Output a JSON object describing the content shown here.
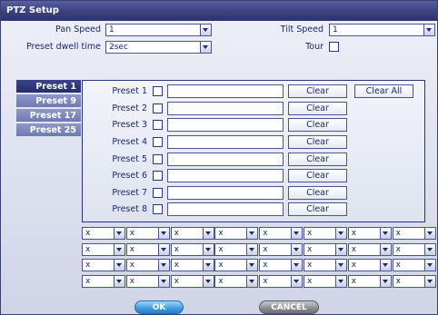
{
  "window": {
    "title": "PTZ Setup"
  },
  "settings": {
    "pan_speed_label": "Pan Speed",
    "pan_speed_value": "1",
    "tilt_speed_label": "Tilt Speed",
    "tilt_speed_value": "1",
    "dwell_label": "Preset dwell time",
    "dwell_value": "2sec",
    "tour_label": "Tour"
  },
  "tabs": [
    {
      "label": "Preset 1",
      "active": true
    },
    {
      "label": "Preset 9",
      "active": false
    },
    {
      "label": "Preset 17",
      "active": false
    },
    {
      "label": "Preset 25",
      "active": false
    }
  ],
  "presets": [
    {
      "label": "Preset 1",
      "clear_label": "Clear"
    },
    {
      "label": "Preset 2",
      "clear_label": "Clear"
    },
    {
      "label": "Preset 3",
      "clear_label": "Clear"
    },
    {
      "label": "Preset 4",
      "clear_label": "Clear"
    },
    {
      "label": "Preset 5",
      "clear_label": "Clear"
    },
    {
      "label": "Preset 6",
      "clear_label": "Clear"
    },
    {
      "label": "Preset 7",
      "clear_label": "Clear"
    },
    {
      "label": "Preset 8",
      "clear_label": "Clear"
    }
  ],
  "clear_all_label": "Clear All",
  "tour_grid": {
    "rows": [
      [
        "x",
        "x",
        "x",
        "x",
        "x",
        "x",
        "x",
        "x"
      ],
      [
        "x",
        "x",
        "x",
        "x",
        "x",
        "x",
        "x",
        "x"
      ],
      [
        "x",
        "x",
        "x",
        "x",
        "x",
        "x",
        "x",
        "x"
      ],
      [
        "x",
        "x",
        "x",
        "x",
        "x",
        "x",
        "x",
        "x"
      ]
    ]
  },
  "buttons": {
    "ok_label": "OK",
    "cancel_label": "CANCEL"
  },
  "colors": {
    "title_bar": "#3d4282",
    "tab_active": "#2f3876",
    "tab_inactive": "#7f89bd",
    "ok_button": "#3d9be0",
    "cancel_button": "#8a8b92"
  }
}
